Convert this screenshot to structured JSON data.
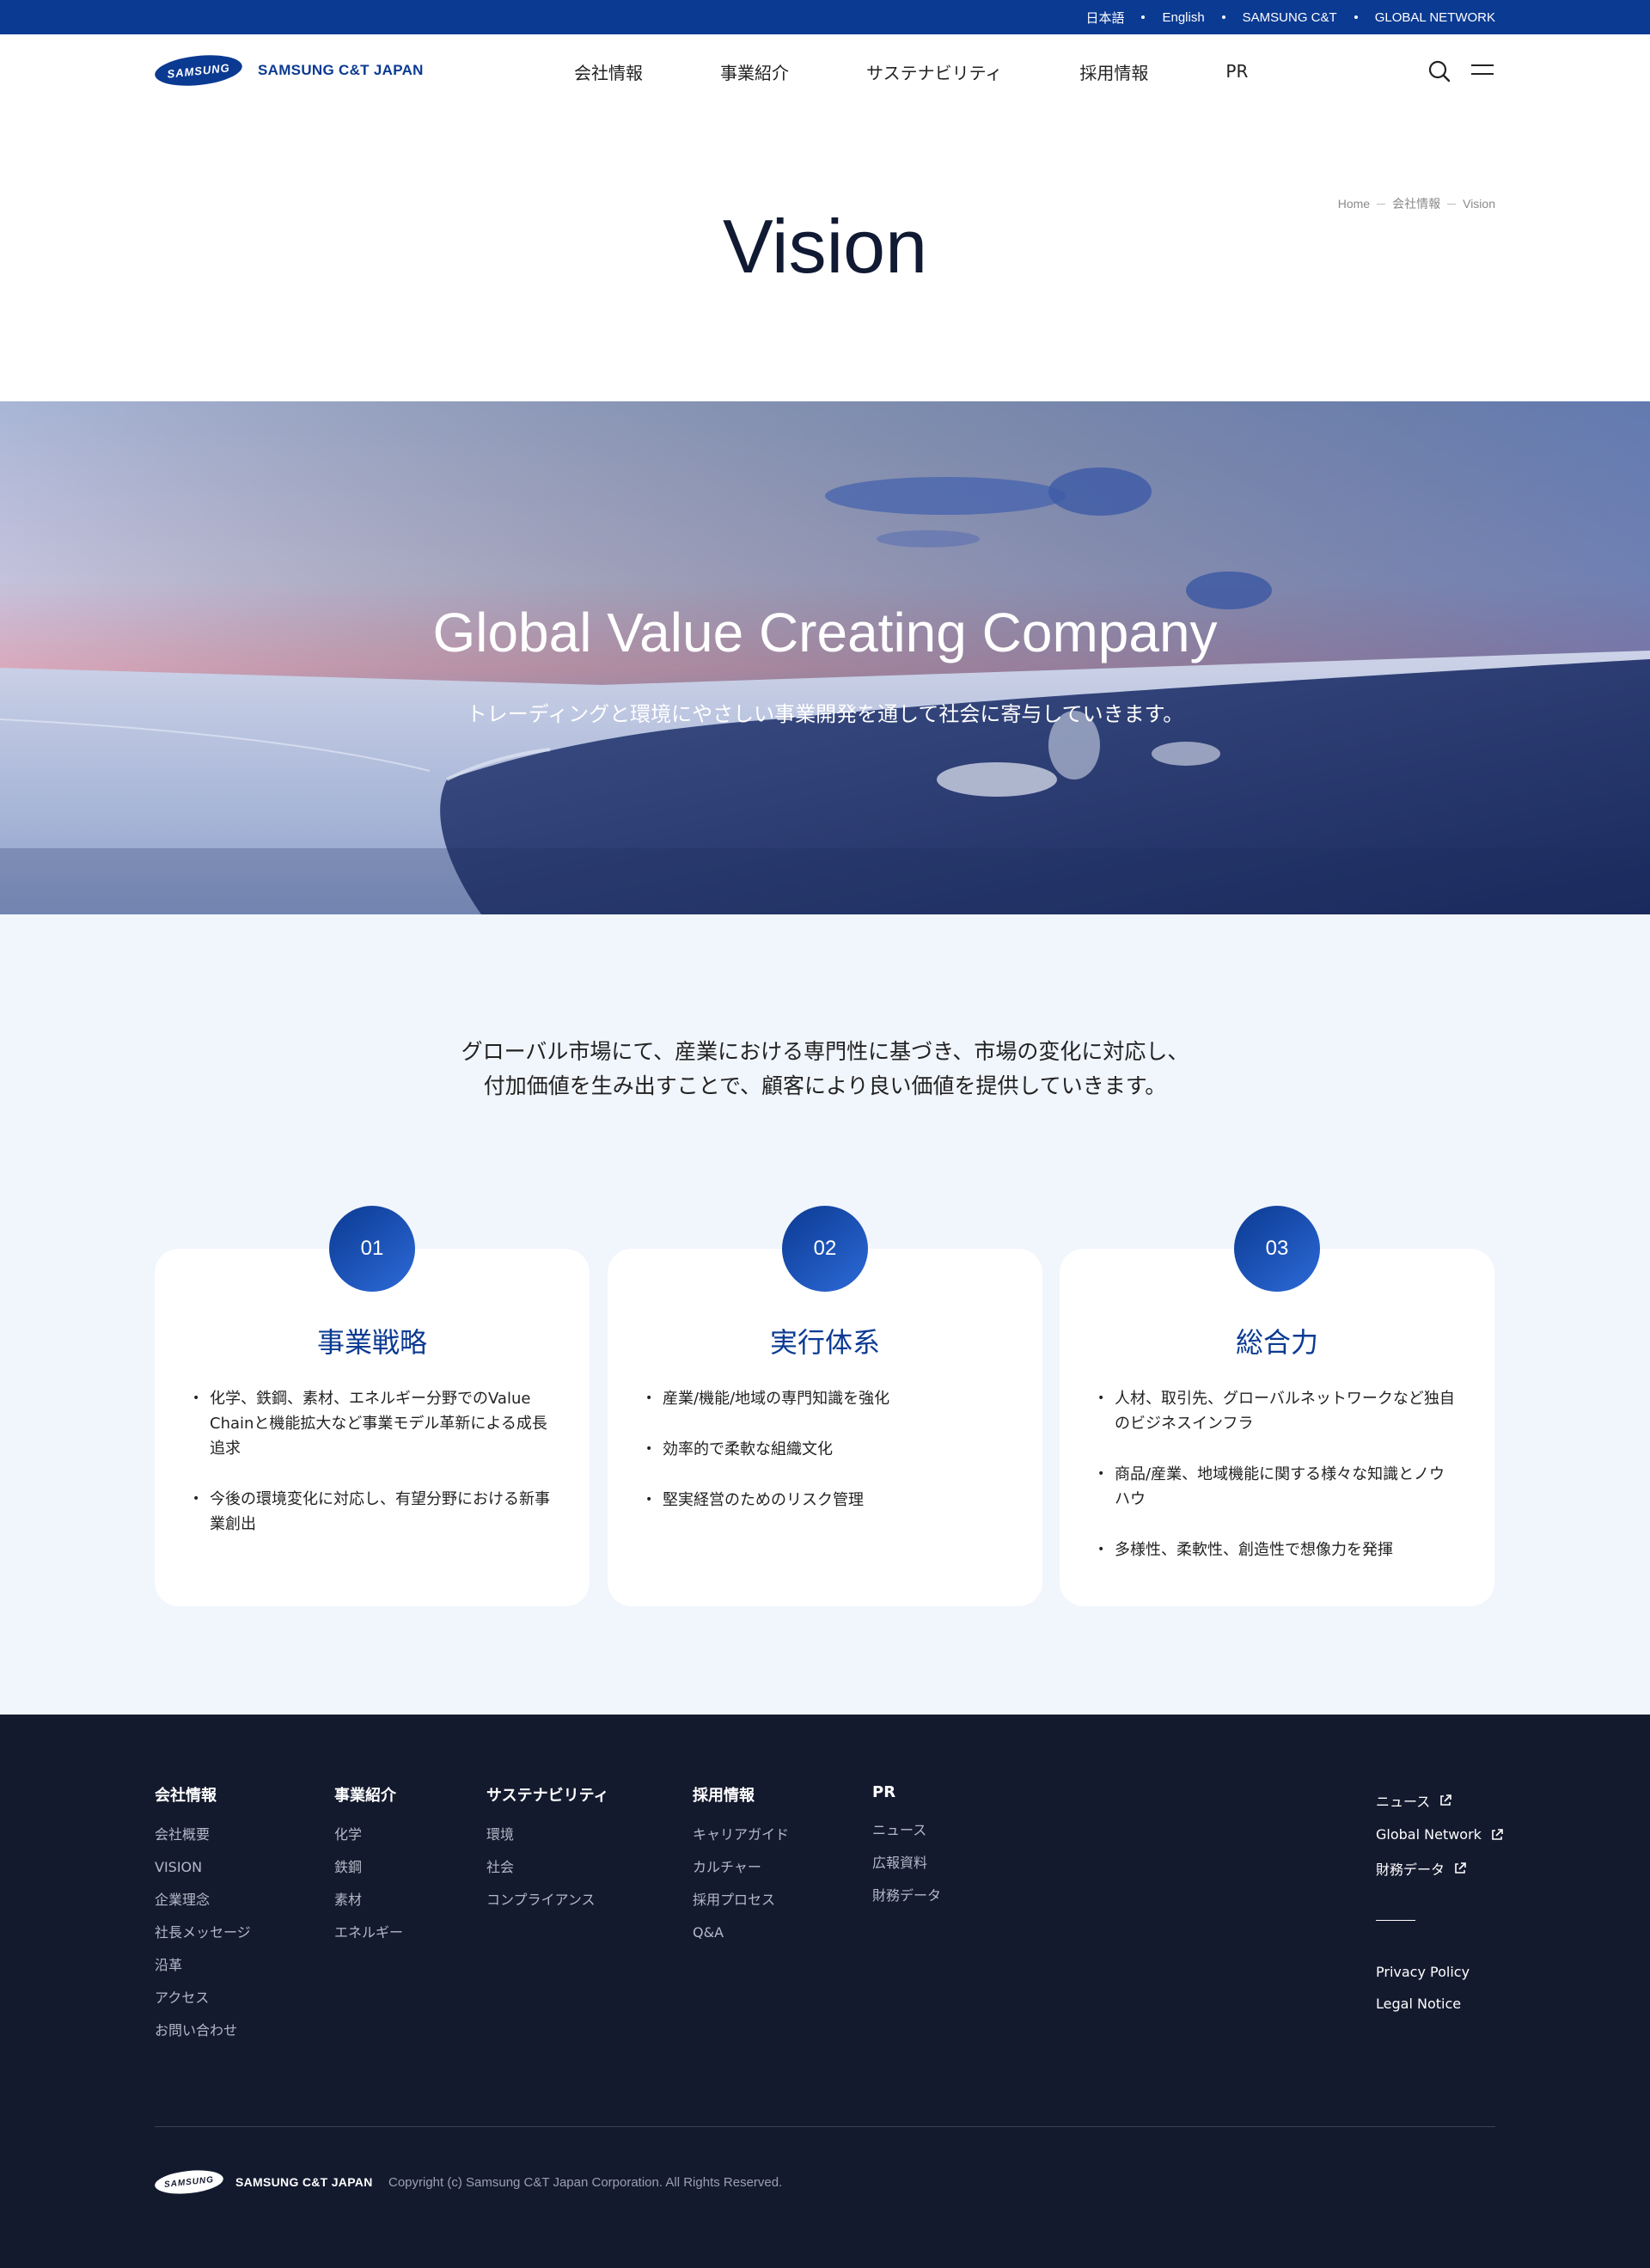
{
  "utility_bar": {
    "links": [
      "日本語",
      "English",
      "SAMSUNG C&T",
      "GLOBAL NETWORK"
    ]
  },
  "header": {
    "logo_mark": "SAMSUNG",
    "logo_text": "SAMSUNG C&T JAPAN",
    "nav": [
      "会社情報",
      "事業紹介",
      "サステナビリティ",
      "採用情報",
      "PR"
    ],
    "icons": [
      "search-icon",
      "menu-icon"
    ]
  },
  "breadcrumb": [
    "Home",
    "会社情報",
    "Vision"
  ],
  "page_title": "Vision",
  "hero": {
    "title": "Global Value Creating Company",
    "subtitle": "トレーディングと環境にやさしい事業開発を通して社会に寄与していきます。"
  },
  "intro": {
    "line1": "グローバル市場にて、産業における専門性に基づき、市場の変化に対応し、",
    "line2": "付加価値を生み出すことで、顧客により良い価値を提供していきます。"
  },
  "cards": [
    {
      "number": "01",
      "title": "事業戦略",
      "items": [
        "化学、鉄鋼、素材、エネルギー分野でのValue Chainと機能拡大など事業モデル革新による成長追求",
        "今後の環境変化に対応し、有望分野における新事業創出"
      ]
    },
    {
      "number": "02",
      "title": "実行体系",
      "items": [
        "産業/機能/地域の専門知識を強化",
        "効率的で柔軟な組織文化",
        "堅実経営のためのリスク管理"
      ]
    },
    {
      "number": "03",
      "title": "総合力",
      "items": [
        "人材、取引先、グローバルネットワークなど独自のビジネスインフラ",
        "商品/産業、地域機能に関する様々な知識とノウハウ",
        "多様性、柔軟性、創造性で想像力を発揮"
      ]
    }
  ],
  "footer": {
    "columns": [
      {
        "heading": "会社情報",
        "links": [
          "会社概要",
          "VISION",
          "企業理念",
          "社長メッセージ",
          "沿革",
          "アクセス",
          "お問い合わせ"
        ]
      },
      {
        "heading": "事業紹介",
        "links": [
          "化学",
          "鉄鋼",
          "素材",
          "エネルギー"
        ]
      },
      {
        "heading": "サステナビリティ",
        "links": [
          "環境",
          "社会",
          "コンプライアンス"
        ]
      },
      {
        "heading": "採用情報",
        "links": [
          "キャリアガイド",
          "カルチャー",
          "採用プロセス",
          "Q&A"
        ]
      },
      {
        "heading": "PR",
        "links": [
          "ニュース",
          "広報資料",
          "財務データ"
        ]
      }
    ],
    "external_links": [
      "ニュース",
      "Global Network",
      "財務データ"
    ],
    "legal_links": [
      "Privacy Policy",
      "Legal Notice"
    ],
    "logo_mark": "SAMSUNG",
    "logo_text": "SAMSUNG C&T JAPAN",
    "copyright": "Copyright (c) Samsung C&T Japan Corporation. All Rights Reserved."
  },
  "colors": {
    "brand_blue": "#0b3a92",
    "footer_bg": "#141a2e",
    "section_bg": "#f1f5fc"
  }
}
